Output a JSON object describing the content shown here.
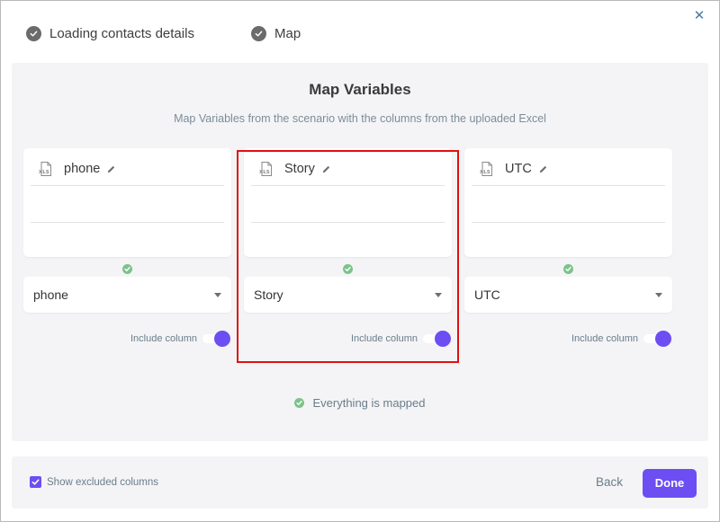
{
  "steps": [
    {
      "label": "Loading contacts details",
      "icon": "check-circle-icon"
    },
    {
      "label": "Map",
      "icon": "check-circle-icon"
    }
  ],
  "panel": {
    "title": "Map Variables",
    "subtitle": "Map Variables from the scenario with the columns from the uploaded Excel"
  },
  "columns": [
    {
      "name": "phone",
      "selected": "phone",
      "include_label": "Include column",
      "include_on": true,
      "file_icon": "xls-file-icon"
    },
    {
      "name": "Story",
      "selected": "Story",
      "include_label": "Include column",
      "include_on": true,
      "file_icon": "xls-file-icon"
    },
    {
      "name": "UTC",
      "selected": "UTC",
      "include_label": "Include column",
      "include_on": true,
      "file_icon": "xls-file-icon"
    }
  ],
  "status": {
    "mapped_text": "Everything is mapped"
  },
  "footer": {
    "show_excluded_label": "Show excluded columns",
    "show_excluded_checked": true,
    "back_label": "Back",
    "done_label": "Done"
  },
  "colors": {
    "accent": "#6c4ef2",
    "success": "#7cc38a",
    "highlight": "#e01111"
  }
}
